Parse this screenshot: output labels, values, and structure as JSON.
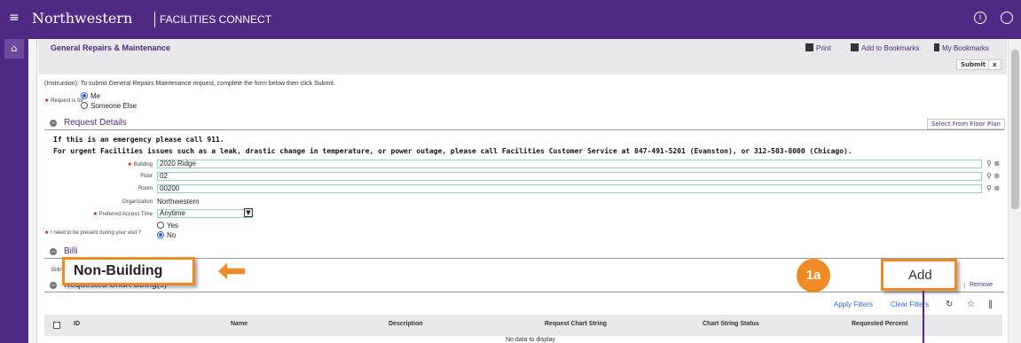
{
  "app": {
    "brand": "Northwestern",
    "subtitle": "FACILITIES CONNECT"
  },
  "page": {
    "title": "General Repairs & Maintenance",
    "print": "Print",
    "add_bookmark": "Add to Bookmarks",
    "my_bookmarks": "My Bookmarks",
    "submit": "Submit",
    "close": "x"
  },
  "form": {
    "instruction": "(Instruction): To submit General Repairs Maintenance request, complete the form below then click Submit.",
    "request_for_label": "Request is for",
    "request_for_options": [
      "Me",
      "Someone Else"
    ],
    "request_details_title": "Request Details",
    "select_floor_plan": "Select From Floor Plan",
    "emergency_notice": "If this is an emergency please call 911.",
    "urgent_notice": "For urgent Facilities issues such as a leak, drastic change in temperature, or power outage, please call Facilities Customer Service at 847-491-5201 (Evanston), or 312-503-8000 (Chicago).",
    "building_label": "Building",
    "building_value": "2020 Ridge",
    "floor_label": "Floor",
    "floor_value": "02",
    "room_label": "Room",
    "room_value": "00200",
    "organization_label": "Organization",
    "organization_value": "Northwestern",
    "access_time_label": "Preferred Access Time",
    "access_time_value": "Anytime",
    "present_label": "I need to be present during your visit ?",
    "present_options": [
      "Yes",
      "No"
    ],
    "billing_title": "Billi",
    "billing_type_label": "Billing Type",
    "chart_string_title": "Requested Chart String(s)",
    "remove": "Remove",
    "apply_filters": "Apply Filters",
    "clear_filters": "Clear Filters"
  },
  "table": {
    "columns": [
      "ID",
      "Name",
      "Description",
      "Request Chart String",
      "Chart String Status",
      "Requested Percent"
    ],
    "empty": "No data to display"
  },
  "annotations": {
    "non_building": "Non-Building",
    "step": "1a",
    "add": "Add",
    "accent_color": "#f08a24",
    "brand_color": "#4e2a84"
  }
}
